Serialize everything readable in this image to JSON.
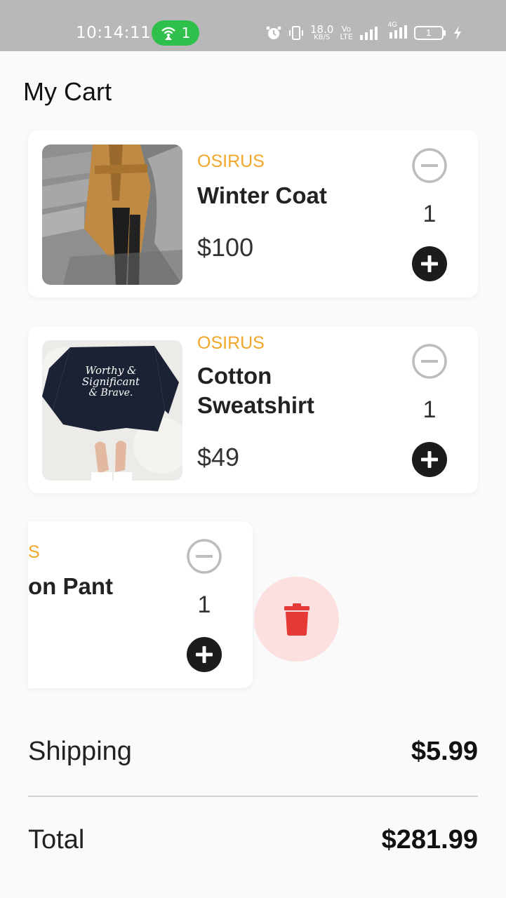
{
  "status_bar": {
    "time": "10:14:11",
    "hotspot_count": "1",
    "net_speed": "18.0",
    "net_unit": "KB/S",
    "volte_top": "Vo",
    "volte_bottom": "LTE",
    "network": "4G",
    "battery": "1"
  },
  "page": {
    "title": "My Cart"
  },
  "items": [
    {
      "brand": "OSIRUS",
      "name": "Winter Coat",
      "price": "$100",
      "qty": "1"
    },
    {
      "brand": "OSIRUS",
      "name": "Cotton Sweatshirt",
      "price": "$49",
      "qty": "1"
    },
    {
      "brand": "S",
      "name": "on Pant",
      "qty": "1"
    }
  ],
  "summary": {
    "shipping_label": "Shipping",
    "shipping_value": "$5.99",
    "total_label": "Total",
    "total_value": "$281.99"
  },
  "colors": {
    "brand": "#f2a72b",
    "delete_bg": "#fcdfdf",
    "delete_icon": "#e53935",
    "hotspot": "#2fbf4b",
    "status_bar": "#b8b8b8"
  }
}
